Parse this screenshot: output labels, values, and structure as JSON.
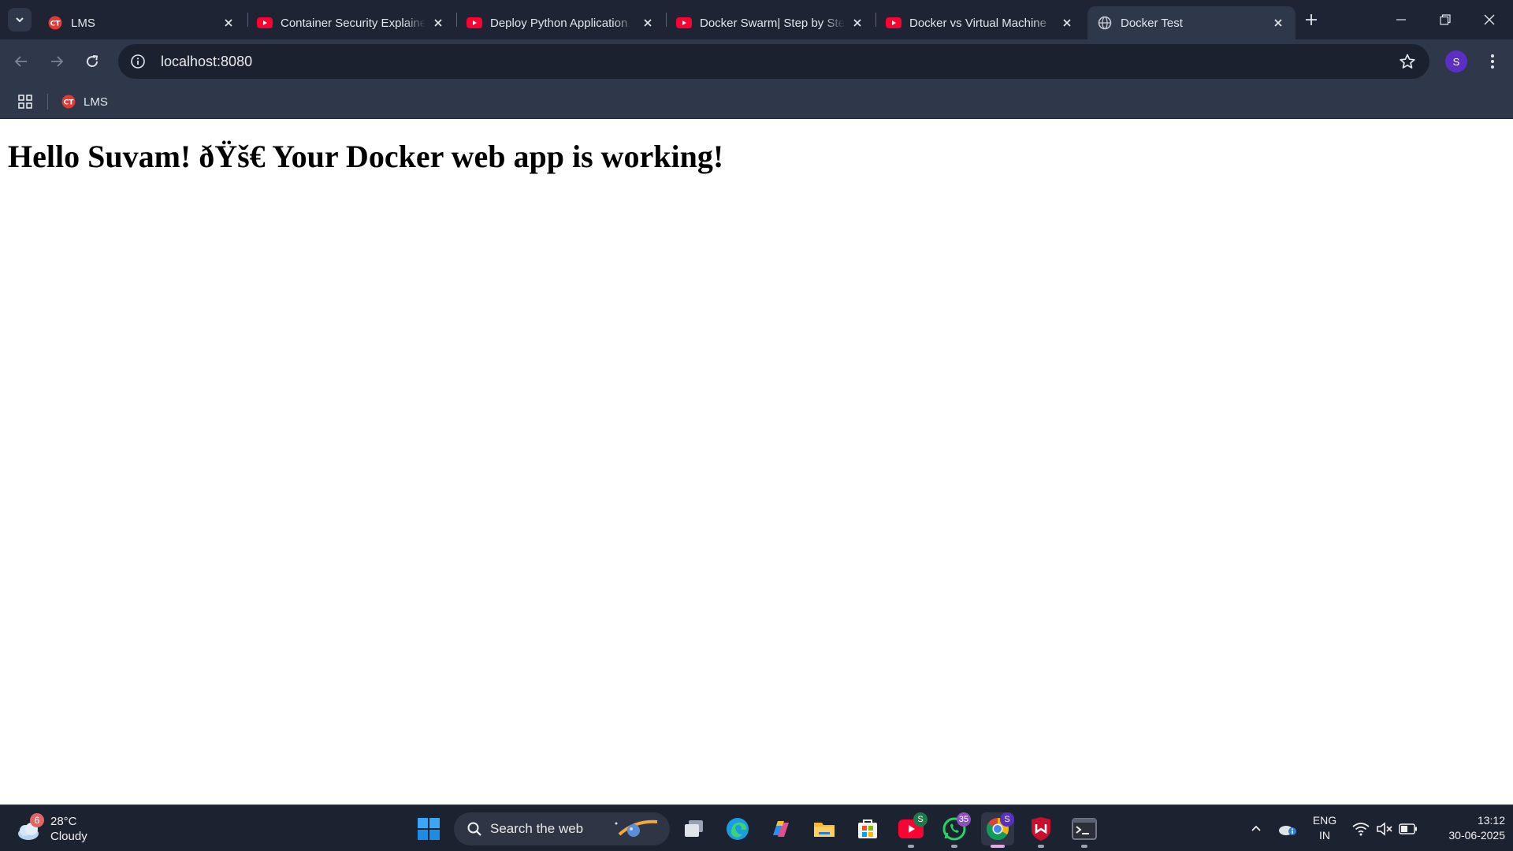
{
  "browser": {
    "tabs": [
      {
        "title": "LMS",
        "favicon": "lms-favicon",
        "active": false
      },
      {
        "title": "Container Security Explained",
        "favicon": "youtube-favicon",
        "active": false
      },
      {
        "title": "Deploy Python Application",
        "favicon": "youtube-favicon",
        "active": false
      },
      {
        "title": "Docker Swarm| Step by Step",
        "favicon": "youtube-favicon",
        "active": false
      },
      {
        "title": "Docker vs Virtual Machine",
        "favicon": "youtube-favicon",
        "active": false
      },
      {
        "title": "Docker Test",
        "favicon": "globe-favicon",
        "active": true
      }
    ],
    "address": "localhost:8080",
    "profile_initial": "S",
    "bookmarks": [
      {
        "label": "LMS",
        "favicon": "lms-favicon"
      }
    ],
    "colors": {
      "tabstrip": "#1e2433",
      "toolbar": "#2f374b",
      "omnibox": "#1c2130",
      "youtube": "#ff0033",
      "lms": "#e53935",
      "profile": "#5b2fc4"
    }
  },
  "page": {
    "heading": "Hello Suvam! ðŸš€ Your Docker web app is working!"
  },
  "taskbar": {
    "weather": {
      "temp": "28°C",
      "condition": "Cloudy",
      "badge": "6"
    },
    "search_placeholder": "Search the web",
    "apps": [
      {
        "name": "windows-start"
      },
      {
        "name": "task-view"
      },
      {
        "name": "edge"
      },
      {
        "name": "copilot"
      },
      {
        "name": "file-explorer"
      },
      {
        "name": "microsoft-store"
      },
      {
        "name": "youtube-app",
        "badge": "S"
      },
      {
        "name": "whatsapp",
        "badge": "35"
      },
      {
        "name": "chrome",
        "badge": "S",
        "active": true
      },
      {
        "name": "mcafee"
      },
      {
        "name": "terminal"
      }
    ],
    "language": {
      "line1": "ENG",
      "line2": "IN"
    },
    "clock": {
      "time": "13:12",
      "date": "30-06-2025"
    }
  }
}
